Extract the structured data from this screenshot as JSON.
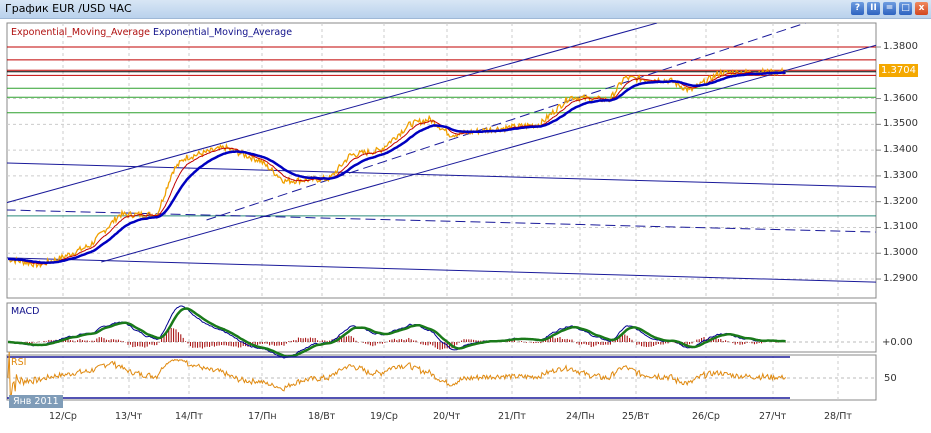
{
  "window": {
    "title": "График EUR /USD  ЧАС",
    "buttons": [
      {
        "name": "help",
        "glyph": "?"
      },
      {
        "name": "pause",
        "glyph": "II"
      },
      {
        "name": "minimize",
        "glyph": "="
      },
      {
        "name": "maximize",
        "glyph": "□"
      },
      {
        "name": "close",
        "glyph": "x"
      }
    ]
  },
  "legend": {
    "ema1": "Exponential_Moving_Average",
    "ema2": "Exponential_Moving_Average"
  },
  "price_axis": {
    "ticks": [
      "1.3800",
      "1.3600",
      "1.3500",
      "1.3400",
      "1.3300",
      "1.3200",
      "1.3100",
      "1.3000",
      "1.2900"
    ],
    "current_price": "1.3704"
  },
  "time_axis": {
    "labels": [
      "12/Ср",
      "13/Чт",
      "14/Пт",
      "17/Пн",
      "18/Вт",
      "19/Ср",
      "20/Чт",
      "21/Пт",
      "24/Пн",
      "25/Вт",
      "26/Ср",
      "27/Чт",
      "28/Пт"
    ],
    "period": "Янв 2011"
  },
  "macd": {
    "label": "MACD",
    "zero_label": "+0.00"
  },
  "rsi": {
    "label": "RSI",
    "mid_label": "50",
    "levels": [
      70,
      30
    ]
  },
  "colors": {
    "price": "#f0a000",
    "ema_fast": "#c00000",
    "ema_slow": "#0000c0",
    "macd": "#1a7a1a",
    "signal": "#000090",
    "hist": "#a00000",
    "rsi": "#e08a10",
    "current_price_bg": "#f4a800"
  },
  "chart_data": {
    "type": "line",
    "ylim": [
      1.285,
      1.389
    ],
    "price_keypoints": [
      [
        -0.87,
        1.298
      ],
      [
        -0.36,
        1.2955
      ],
      [
        -0.05,
        1.298
      ],
      [
        0.41,
        1.303
      ],
      [
        0.86,
        1.315
      ],
      [
        1.47,
        1.315
      ],
      [
        1.73,
        1.332
      ],
      [
        1.93,
        1.337
      ],
      [
        2.49,
        1.341
      ],
      [
        2.97,
        1.336
      ],
      [
        3.38,
        1.328
      ],
      [
        4.13,
        1.329
      ],
      [
        4.45,
        1.338
      ],
      [
        4.94,
        1.34
      ],
      [
        5.41,
        1.35
      ],
      [
        5.73,
        1.352
      ],
      [
        6.05,
        1.346
      ],
      [
        6.68,
        1.348
      ],
      [
        7.41,
        1.35
      ],
      [
        7.85,
        1.3606
      ],
      [
        8.53,
        1.3594
      ],
      [
        8.79,
        1.368
      ],
      [
        9.49,
        1.367
      ],
      [
        9.77,
        1.363
      ],
      [
        10.21,
        1.37
      ],
      [
        11.21,
        1.3704
      ]
    ],
    "horizontal_levels": [
      {
        "price": 1.38,
        "color": "#c00000"
      },
      {
        "price": 1.375,
        "color": "#c00000"
      },
      {
        "price": 1.371,
        "color": "#c00000"
      },
      {
        "price": 1.3704,
        "color": "#000000"
      },
      {
        "price": 1.369,
        "color": "#c00000"
      },
      {
        "price": 1.364,
        "color": "#2ea02e"
      },
      {
        "price": 1.3605,
        "color": "#2ea02e"
      },
      {
        "price": 1.3545,
        "color": "#2ea02e"
      },
      {
        "price": 1.3145,
        "color": "#2a8a7a"
      }
    ],
    "trend_lines": [
      {
        "from": [
          -0.87,
          1.3195
        ],
        "to": [
          9.3,
          1.3893
        ],
        "dashed": false
      },
      {
        "from": [
          2.24,
          1.3129
        ],
        "to": [
          11.5,
          1.3893
        ],
        "dashed": true
      },
      {
        "from": [
          0.58,
          1.2966
        ],
        "to": [
          12.6,
          1.3808
        ],
        "dashed": false
      },
      {
        "from": [
          -0.87,
          1.335
        ],
        "to": [
          12.6,
          1.3257
        ],
        "dashed": false
      },
      {
        "from": [
          -0.87,
          1.3168
        ],
        "to": [
          12.6,
          1.3082
        ],
        "dashed": true
      },
      {
        "from": [
          -0.87,
          1.2982
        ],
        "to": [
          12.6,
          1.2888
        ],
        "dashed": false
      }
    ]
  }
}
